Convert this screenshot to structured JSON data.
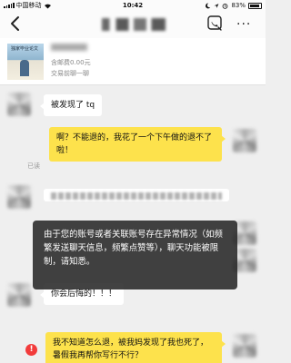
{
  "status_bar": {
    "carrier": "中国移动",
    "time": "10:42",
    "battery_percent": "83%"
  },
  "nav": {
    "back_icon": "chevron-left-icon",
    "call_icon": "phone-call-icon",
    "more_label": "···"
  },
  "product": {
    "thumb_text": "独家毕业论文",
    "price": "含邮费0.00元",
    "status": "交易前聊一聊"
  },
  "messages": [
    {
      "side": "left",
      "text": "被发现了 tq"
    },
    {
      "side": "right",
      "text": "啊？不能退的，我花了一个下午做的退不了啦！",
      "read_label": "已读"
    },
    {
      "side": "left",
      "text": "你会后悔的！！！"
    },
    {
      "side": "right",
      "text": "我不知道怎么退，被我妈发现了我也死了，暑假我再帮你写行不行？"
    }
  ],
  "toast": {
    "text": "由于您的账号或者关联账号存在异常情况（如频繁发送聊天信息，频繁点赞等），聊天功能被限制，请知悉。"
  },
  "colors": {
    "background": "#efefef",
    "self_bubble": "#fde24c",
    "other_bubble": "#ffffff",
    "toast_bg": "#282828",
    "warning": "#f23b3b"
  }
}
